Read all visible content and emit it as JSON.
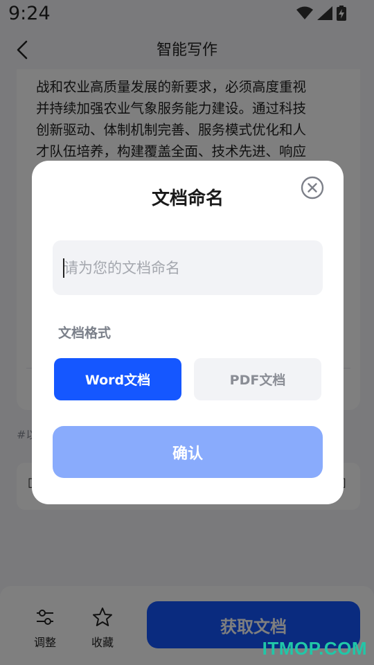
{
  "status_bar": {
    "time": "9:24"
  },
  "header": {
    "title": "智能写作"
  },
  "article": {
    "lines": [
      "战和农业高质量发展的新要求，必须高度重视",
      "并持续加强农业气象服务能力建设。通过科技",
      "创新驱动、体制机制完善、服务模式优化和人",
      "才队伍培养，构建覆盖全面、技术先进、响应"
    ]
  },
  "hashtag_partial": "#以",
  "bottom_bar": {
    "adjust_label": "调整",
    "favorite_label": "收藏",
    "get_doc_label": "获取文档"
  },
  "dialog": {
    "title": "文档命名",
    "input_placeholder": "请为您的文档命名",
    "input_value": "",
    "format_label": "文档格式",
    "formats": [
      {
        "label": "Word文档",
        "selected": true
      },
      {
        "label": "PDF文档",
        "selected": false
      }
    ],
    "confirm_label": "确认"
  },
  "watermark": "ITMOP.COM",
  "colors": {
    "accent": "#1557ff",
    "confirm_disabled": "#89abfc",
    "input_bg": "#f2f3f6",
    "overlay": "rgba(0,0,0,0.5)",
    "watermark": "#21c7a8"
  },
  "icons": {
    "back": "chevron-left-icon",
    "close": "close-circle-icon",
    "adjust": "sliders-icon",
    "favorite": "star-icon",
    "wifi": "wifi-icon",
    "signal": "signal-icon",
    "battery": "battery-charging-icon"
  }
}
